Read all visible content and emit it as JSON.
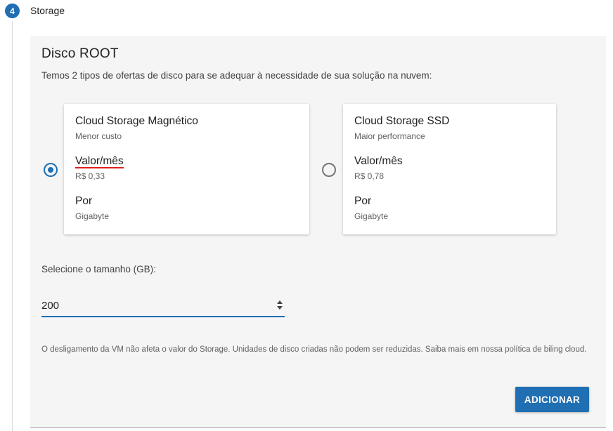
{
  "step": {
    "number": "4",
    "label": "Storage"
  },
  "panel": {
    "title": "Disco ROOT",
    "subtitle": "Temos 2 tipos de ofertas de disco para se adequar à necessidade de sua solução na nuvem:"
  },
  "options": [
    {
      "title": "Cloud Storage Magnético",
      "subtitle": "Menor custo",
      "price_label": "Valor/mês",
      "price": "R$ 0,33",
      "per_label": "Por",
      "per": "Gigabyte",
      "selected": true
    },
    {
      "title": "Cloud Storage SSD",
      "subtitle": "Maior performance",
      "price_label": "Valor/mês",
      "price": "R$ 0,78",
      "per_label": "Por",
      "per": "Gigabyte",
      "selected": false
    }
  ],
  "size": {
    "label": "Selecione o tamanho (GB):",
    "value": "200"
  },
  "note": "O desligamento da VM não afeta o valor do Storage. Unidades de disco criadas não podem ser reduzidas. Saiba mais em nossa política de biling cloud.",
  "actions": {
    "add_label": "ADICIONAR"
  },
  "colors": {
    "accent": "#1f6fb2",
    "annotation_underline": "#e0201e"
  }
}
